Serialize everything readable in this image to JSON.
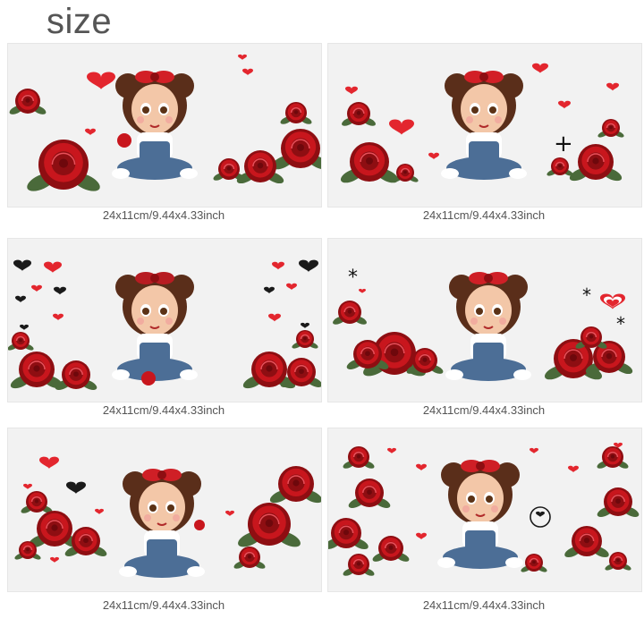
{
  "heading": "size",
  "colors": {
    "rose": "#c8161d",
    "rose_dark": "#8e0e12",
    "leaf": "#4a6a3a",
    "heart": "#e3262e",
    "hair": "#5a2e1a",
    "skin": "#f3c7a8",
    "denim": "#4c6e96",
    "card_bg": "#f2f2f2"
  },
  "cards": [
    {
      "caption": "24x11cm/9.44x4.33inch",
      "motif": "girl-with-strawberry-and-roses"
    },
    {
      "caption": "24x11cm/9.44x4.33inch",
      "motif": "girl-with-heart-bow-and-roses"
    },
    {
      "caption": "24x11cm/9.44x4.33inch",
      "motif": "girl-with-black-and-red-hearts"
    },
    {
      "caption": "24x11cm/9.44x4.33inch",
      "motif": "girl-with-stars-and-roses"
    },
    {
      "caption": "24x11cm/9.44x4.33inch",
      "motif": "girl-with-rose-and-black-heart"
    },
    {
      "caption": "24x11cm/9.44x4.33inch",
      "motif": "girl-with-rose-garland"
    }
  ]
}
